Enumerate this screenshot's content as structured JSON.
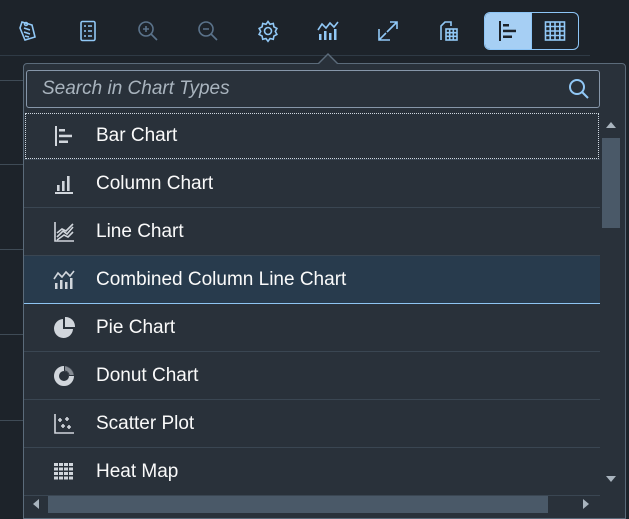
{
  "toolbar": {
    "buttons": [
      {
        "name": "legend-icon",
        "disabled": false
      },
      {
        "name": "details-icon",
        "disabled": false
      },
      {
        "name": "zoom-in-icon",
        "disabled": true
      },
      {
        "name": "zoom-out-icon",
        "disabled": true
      },
      {
        "name": "settings-icon",
        "disabled": false
      },
      {
        "name": "chart-type-icon",
        "disabled": false
      },
      {
        "name": "full-screen-icon",
        "disabled": false
      },
      {
        "name": "download-icon",
        "disabled": false
      }
    ],
    "view_toggle": {
      "chart_view": "bar-chart-icon",
      "table_view": "table-icon",
      "active": "chart_view"
    }
  },
  "search": {
    "placeholder": "Search in Chart Types",
    "value": ""
  },
  "chart_types": [
    {
      "label": "Bar Chart",
      "icon": "bar-chart-icon",
      "focused": true,
      "selected": false
    },
    {
      "label": "Column Chart",
      "icon": "column-chart-icon",
      "focused": false,
      "selected": false
    },
    {
      "label": "Line Chart",
      "icon": "line-chart-icon",
      "focused": false,
      "selected": false
    },
    {
      "label": "Combined Column Line Chart",
      "icon": "combined-column-line-chart-icon",
      "focused": false,
      "selected": true
    },
    {
      "label": "Pie Chart",
      "icon": "pie-chart-icon",
      "focused": false,
      "selected": false
    },
    {
      "label": "Donut Chart",
      "icon": "donut-chart-icon",
      "focused": false,
      "selected": false
    },
    {
      "label": "Scatter Plot",
      "icon": "scatter-plot-icon",
      "focused": false,
      "selected": false
    },
    {
      "label": "Heat Map",
      "icon": "heat-map-icon",
      "focused": false,
      "selected": false
    }
  ],
  "colors": {
    "accent": "#91c8f6",
    "background": "#1d232a",
    "popover": "#29313a",
    "selected_row": "#283b4d"
  }
}
